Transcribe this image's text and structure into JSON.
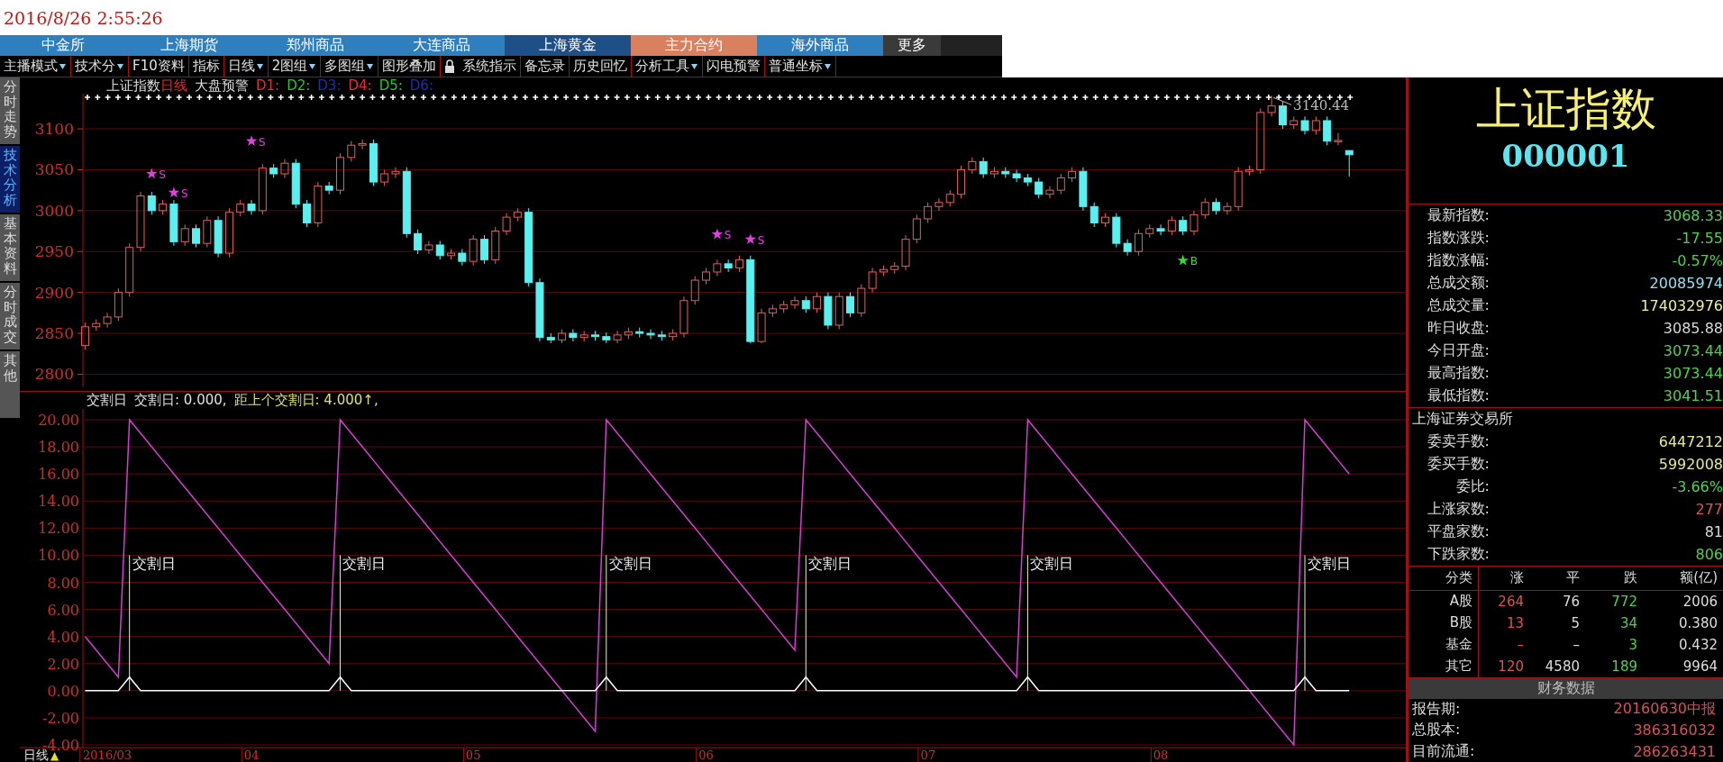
{
  "clock": "2016/8/26 2:55:26",
  "market_tabs": [
    {
      "label": "中金所",
      "color": "#2f7fbf"
    },
    {
      "label": "上海期货",
      "color": "#2f7fbf"
    },
    {
      "label": "郑州商品",
      "color": "#2f7fbf"
    },
    {
      "label": "大连商品",
      "color": "#2f7fbf"
    },
    {
      "label": "上海黄金",
      "color": "#1e4f86"
    },
    {
      "label": "主力合约",
      "color": "#d9805f"
    },
    {
      "label": "海外商品",
      "color": "#2f7fbf"
    },
    {
      "label": "更多",
      "color": "#3a3a3a"
    }
  ],
  "toolbar": [
    {
      "label": "主播模式",
      "dropdown": true
    },
    {
      "label": "技术分",
      "dropdown": true
    },
    {
      "label": "F10资料",
      "dropdown": false
    },
    {
      "label": "指标",
      "dropdown": false
    },
    {
      "label": "日线",
      "dropdown": true
    },
    {
      "label": "2图组",
      "dropdown": true
    },
    {
      "label": "多图组",
      "dropdown": true
    },
    {
      "label": "图形叠加",
      "dropdown": false
    },
    {
      "kind": "lock"
    },
    {
      "label": "系统指示",
      "dropdown": false
    },
    {
      "label": "备忘录",
      "dropdown": false
    },
    {
      "label": "历史回忆",
      "dropdown": false
    },
    {
      "label": "分析工具",
      "dropdown": true
    },
    {
      "label": "闪电预警",
      "dropdown": false
    },
    {
      "label": "普通坐标",
      "dropdown": true
    }
  ],
  "side_tabs": [
    {
      "label": "分时走势",
      "selected": false
    },
    {
      "label": "技术分析",
      "selected": true
    },
    {
      "label": "基本资料",
      "selected": false
    },
    {
      "label": "分时成交",
      "selected": false
    },
    {
      "label": "其他",
      "selected": false
    }
  ],
  "price_chart": {
    "title": "上证指数",
    "period": "日线",
    "alert": "大盘预警",
    "d_labels": [
      {
        "text": "D1:",
        "color": "#e03030"
      },
      {
        "text": "D2:",
        "color": "#30c030"
      },
      {
        "text": "D3:",
        "color": "#2030a0"
      },
      {
        "text": "D4:",
        "color": "#e03030"
      },
      {
        "text": "D5:",
        "color": "#30c030"
      },
      {
        "text": "D6:",
        "color": "#2030a0"
      }
    ],
    "high_label": "3140.44",
    "signals": [
      {
        "kind": "sell",
        "text": "S"
      },
      {
        "kind": "sell",
        "text": "S"
      },
      {
        "kind": "sell",
        "text": "S"
      },
      {
        "kind": "sell",
        "text": "S"
      },
      {
        "kind": "sell",
        "text": "S"
      },
      {
        "kind": "buy",
        "text": "B"
      }
    ],
    "chart_data": {
      "type": "candlestick",
      "grid": true,
      "categories": [
        null,
        null,
        null,
        null,
        null,
        null,
        null,
        null,
        null,
        null,
        null,
        null,
        null,
        null,
        null,
        null,
        null,
        null,
        null,
        null,
        null,
        null,
        null,
        null,
        null,
        null,
        null,
        null,
        null,
        null,
        null,
        null,
        null,
        null,
        null,
        null,
        null,
        null,
        null,
        null,
        null,
        null,
        null,
        null,
        null,
        null,
        null,
        null,
        null,
        null,
        null,
        null,
        null,
        null,
        null,
        null,
        null,
        null,
        null,
        null,
        null,
        null,
        null,
        null,
        null,
        null,
        null,
        null,
        null,
        null,
        null,
        null,
        null,
        null,
        null,
        null,
        null,
        null,
        null,
        null,
        null,
        null,
        null,
        null,
        null,
        null,
        null,
        null,
        null,
        null,
        null,
        null,
        null,
        null,
        null,
        null,
        null,
        null,
        null,
        null,
        null,
        null,
        null,
        null,
        null,
        null,
        null,
        null,
        null,
        null,
        null,
        null,
        null,
        null,
        null
      ],
      "ohlc": [
        [
          2835,
          2863,
          2830,
          2858
        ],
        [
          2858,
          2867,
          2853,
          2862
        ],
        [
          2862,
          2875,
          2857,
          2870
        ],
        [
          2870,
          2905,
          2865,
          2900
        ],
        [
          2900,
          2960,
          2895,
          2955
        ],
        [
          2955,
          3023,
          2950,
          3018
        ],
        [
          3018,
          3023,
          2995,
          3000
        ],
        [
          3000,
          3013,
          2995,
          3008
        ],
        [
          3008,
          3013,
          2957,
          2962
        ],
        [
          2962,
          2983,
          2957,
          2978
        ],
        [
          2978,
          2983,
          2955,
          2960
        ],
        [
          2960,
          2993,
          2955,
          2988
        ],
        [
          2988,
          2993,
          2943,
          2948
        ],
        [
          2948,
          3003,
          2943,
          2998
        ],
        [
          2998,
          3013,
          2993,
          3008
        ],
        [
          3008,
          3013,
          2995,
          3000
        ],
        [
          3000,
          3057,
          2995,
          3052
        ],
        [
          3052,
          3057,
          3040,
          3045
        ],
        [
          3045,
          3063,
          3040,
          3058
        ],
        [
          3058,
          3063,
          3003,
          3008
        ],
        [
          3008,
          3013,
          2980,
          2985
        ],
        [
          2985,
          3035,
          2980,
          3030
        ],
        [
          3030,
          3035,
          3020,
          3025
        ],
        [
          3025,
          3070,
          3020,
          3065
        ],
        [
          3065,
          3085,
          3060,
          3080
        ],
        [
          3080,
          3087,
          3075,
          3082
        ],
        [
          3082,
          3087,
          3030,
          3035
        ],
        [
          3035,
          3050,
          3030,
          3045
        ],
        [
          3045,
          3053,
          3040,
          3048
        ],
        [
          3048,
          3053,
          2967,
          2972
        ],
        [
          2972,
          2977,
          2947,
          2952
        ],
        [
          2952,
          2963,
          2947,
          2958
        ],
        [
          2958,
          2963,
          2940,
          2945
        ],
        [
          2945,
          2953,
          2940,
          2948
        ],
        [
          2948,
          2953,
          2933,
          2938
        ],
        [
          2938,
          2970,
          2933,
          2965
        ],
        [
          2965,
          2970,
          2935,
          2940
        ],
        [
          2940,
          2980,
          2935,
          2975
        ],
        [
          2975,
          2997,
          2970,
          2992
        ],
        [
          2992,
          3003,
          2987,
          2998
        ],
        [
          2998,
          3003,
          2907,
          2912
        ],
        [
          2912,
          2917,
          2840,
          2845
        ],
        [
          2845,
          2850,
          2838,
          2842
        ],
        [
          2842,
          2855,
          2838,
          2850
        ],
        [
          2850,
          2855,
          2840,
          2845
        ],
        [
          2845,
          2853,
          2840,
          2848
        ],
        [
          2848,
          2853,
          2841,
          2846
        ],
        [
          2846,
          2851,
          2838,
          2842
        ],
        [
          2842,
          2853,
          2838,
          2848
        ],
        [
          2848,
          2857,
          2843,
          2852
        ],
        [
          2852,
          2857,
          2845,
          2850
        ],
        [
          2850,
          2855,
          2843,
          2848
        ],
        [
          2848,
          2853,
          2841,
          2846
        ],
        [
          2846,
          2855,
          2841,
          2850
        ],
        [
          2850,
          2895,
          2845,
          2890
        ],
        [
          2890,
          2920,
          2885,
          2915
        ],
        [
          2915,
          2930,
          2910,
          2925
        ],
        [
          2925,
          2940,
          2920,
          2935
        ],
        [
          2935,
          2940,
          2925,
          2930
        ],
        [
          2930,
          2945,
          2925,
          2940
        ],
        [
          2940,
          2945,
          2838,
          2840
        ],
        [
          2840,
          2880,
          2838,
          2875
        ],
        [
          2875,
          2885,
          2870,
          2880
        ],
        [
          2880,
          2890,
          2875,
          2885
        ],
        [
          2885,
          2895,
          2880,
          2890
        ],
        [
          2890,
          2895,
          2875,
          2880
        ],
        [
          2880,
          2900,
          2875,
          2895
        ],
        [
          2895,
          2900,
          2855,
          2860
        ],
        [
          2860,
          2900,
          2855,
          2895
        ],
        [
          2895,
          2900,
          2870,
          2875
        ],
        [
          2875,
          2910,
          2870,
          2905
        ],
        [
          2905,
          2930,
          2900,
          2925
        ],
        [
          2925,
          2933,
          2920,
          2928
        ],
        [
          2928,
          2937,
          2923,
          2932
        ],
        [
          2932,
          2970,
          2927,
          2965
        ],
        [
          2965,
          2995,
          2960,
          2990
        ],
        [
          2990,
          3010,
          2985,
          3005
        ],
        [
          3005,
          3015,
          3000,
          3010
        ],
        [
          3010,
          3025,
          3005,
          3020
        ],
        [
          3020,
          3055,
          3015,
          3050
        ],
        [
          3050,
          3065,
          3045,
          3060
        ],
        [
          3060,
          3065,
          3040,
          3045
        ],
        [
          3045,
          3053,
          3040,
          3048
        ],
        [
          3048,
          3053,
          3040,
          3045
        ],
        [
          3045,
          3050,
          3035,
          3040
        ],
        [
          3040,
          3045,
          3030,
          3035
        ],
        [
          3035,
          3040,
          3015,
          3020
        ],
        [
          3020,
          3030,
          3015,
          3025
        ],
        [
          3025,
          3045,
          3020,
          3040
        ],
        [
          3040,
          3053,
          3035,
          3048
        ],
        [
          3048,
          3053,
          3000,
          3005
        ],
        [
          3005,
          3010,
          2980,
          2985
        ],
        [
          2985,
          2997,
          2980,
          2992
        ],
        [
          2992,
          2997,
          2955,
          2960
        ],
        [
          2960,
          2965,
          2945,
          2950
        ],
        [
          2950,
          2977,
          2945,
          2972
        ],
        [
          2972,
          2983,
          2967,
          2978
        ],
        [
          2978,
          2983,
          2970,
          2975
        ],
        [
          2975,
          2993,
          2970,
          2988
        ],
        [
          2988,
          2993,
          2970,
          2975
        ],
        [
          2975,
          3000,
          2970,
          2995
        ],
        [
          2995,
          3015,
          2990,
          3010
        ],
        [
          3010,
          3015,
          2995,
          3000
        ],
        [
          3000,
          3010,
          2995,
          3005
        ],
        [
          3005,
          3053,
          3000,
          3048
        ],
        [
          3048,
          3055,
          3043,
          3050
        ],
        [
          3050,
          3125,
          3045,
          3120
        ],
        [
          3120,
          3140.44,
          3115,
          3128
        ],
        [
          3128,
          3133,
          3100,
          3105
        ],
        [
          3105,
          3115,
          3100,
          3110
        ],
        [
          3110,
          3115,
          3093,
          3098
        ],
        [
          3098,
          3115,
          3093,
          3110
        ],
        [
          3110,
          3115,
          3080,
          3085
        ],
        [
          3085,
          3095,
          3080,
          3085.88
        ],
        [
          3073.44,
          3073.44,
          3041.51,
          3068.33
        ]
      ],
      "ylim": [
        2784,
        3143
      ],
      "yticks": [
        {
          "value": 3100,
          "label": "3100"
        },
        {
          "value": 3050,
          "label": "3050"
        },
        {
          "value": 3000,
          "label": "3000"
        },
        {
          "value": 2950,
          "label": "2950"
        },
        {
          "value": 2900,
          "label": "2900"
        },
        {
          "value": 2850,
          "label": "2850"
        },
        {
          "value": 2800,
          "label": "2800"
        }
      ]
    }
  },
  "indicator": {
    "legend": [
      {
        "text": "交割日",
        "color": "#e0e0e0"
      },
      {
        "text": "交割日: 0.000,",
        "color": "#e0e0e0"
      },
      {
        "text": "距上个交割日: 4.000↑,",
        "color": "#e0e070"
      }
    ],
    "chart_data": {
      "type": "line",
      "categories": [
        null,
        null,
        "2016/03",
        null,
        null,
        null,
        null,
        null,
        null,
        null,
        null,
        null,
        null,
        null,
        null,
        "04",
        null,
        null,
        null,
        null,
        null,
        null,
        null,
        null,
        null,
        null,
        null,
        null,
        null,
        null,
        null,
        null,
        null,
        null,
        null,
        "05",
        null,
        null,
        null,
        null,
        null,
        null,
        null,
        null,
        null,
        null,
        null,
        null,
        null,
        null,
        null,
        null,
        null,
        null,
        null,
        null,
        "06",
        null,
        null,
        null,
        null,
        null,
        null,
        null,
        null,
        null,
        null,
        null,
        null,
        null,
        null,
        null,
        null,
        null,
        null,
        null,
        "07",
        null,
        null,
        null,
        null,
        null,
        null,
        null,
        null,
        null,
        null,
        null,
        null,
        null,
        null,
        null,
        null,
        null,
        null,
        null,
        null,
        "08",
        null,
        null,
        null,
        null,
        null,
        null,
        null,
        null,
        null,
        null,
        null,
        null,
        null,
        null,
        null,
        null,
        null
      ],
      "series": [
        {
          "color": "#d040d0",
          "values": [
            4,
            3,
            2,
            1,
            20,
            19,
            18,
            17,
            16,
            15,
            14,
            13,
            12,
            11,
            10,
            9,
            8,
            7,
            6,
            5,
            4,
            3,
            2,
            20,
            19,
            18,
            17,
            16,
            15,
            14,
            13,
            12,
            11,
            10,
            9,
            8,
            7,
            6,
            5,
            4,
            3,
            2,
            1,
            0,
            -1,
            -2,
            -3,
            20,
            19,
            18,
            17,
            16,
            15,
            14,
            13,
            12,
            11,
            10,
            9,
            8,
            7,
            6,
            5,
            4,
            3,
            20,
            19,
            18,
            17,
            16,
            15,
            14,
            13,
            12,
            11,
            10,
            9,
            8,
            7,
            6,
            5,
            4,
            3,
            2,
            1,
            20,
            19,
            18,
            17,
            16,
            15,
            14,
            13,
            12,
            11,
            10,
            9,
            8,
            7,
            6,
            5,
            4,
            3,
            2,
            1,
            0,
            -1,
            -2,
            -3,
            -4,
            20,
            19,
            18,
            17,
            16
          ]
        },
        {
          "color": "#ffffff",
          "values": [
            0,
            0,
            0,
            0,
            1,
            0,
            0,
            0,
            0,
            0,
            0,
            0,
            0,
            0,
            0,
            0,
            0,
            0,
            0,
            0,
            0,
            0,
            0,
            1,
            0,
            0,
            0,
            0,
            0,
            0,
            0,
            0,
            0,
            0,
            0,
            0,
            0,
            0,
            0,
            0,
            0,
            0,
            0,
            0,
            0,
            0,
            0,
            1,
            0,
            0,
            0,
            0,
            0,
            0,
            0,
            0,
            0,
            0,
            0,
            0,
            0,
            0,
            0,
            0,
            0,
            1,
            0,
            0,
            0,
            0,
            0,
            0,
            0,
            0,
            0,
            0,
            0,
            0,
            0,
            0,
            0,
            0,
            0,
            0,
            0,
            1,
            0,
            0,
            0,
            0,
            0,
            0,
            0,
            0,
            0,
            0,
            0,
            0,
            0,
            0,
            0,
            0,
            0,
            0,
            0,
            0,
            0,
            0,
            0,
            0,
            1,
            0,
            0,
            0,
            0
          ]
        }
      ],
      "ylim": [
        -4,
        20
      ],
      "grid": true,
      "yticks": [
        {
          "value": 20,
          "label": "20.00"
        },
        {
          "value": 18,
          "label": "18.00"
        },
        {
          "value": 16,
          "label": "16.00"
        },
        {
          "value": 14,
          "label": "14.00"
        },
        {
          "value": 12,
          "label": "12.00"
        },
        {
          "value": 10,
          "label": "10.00"
        },
        {
          "value": 8,
          "label": "8.00"
        },
        {
          "value": 6,
          "label": "6.00"
        },
        {
          "value": 4,
          "label": "4.00"
        },
        {
          "value": 2,
          "label": "2.00"
        },
        {
          "value": 0,
          "label": "0.00"
        },
        {
          "value": -2,
          "label": "-2.00"
        },
        {
          "value": -4,
          "label": "-4.00"
        }
      ],
      "annotations": [
        "交割日",
        "交割日",
        "交割日",
        "交割日",
        "交割日",
        "交割日"
      ]
    }
  },
  "period_button": {
    "label": "日线",
    "icon": "▲"
  },
  "quote": {
    "name": "上证指数",
    "code": "000001",
    "stats": [
      {
        "label": "最新指数:",
        "value": "3068.33",
        "color": "#50d050"
      },
      {
        "label": "指数涨跌:",
        "value": "-17.55",
        "color": "#50d050"
      },
      {
        "label": "指数涨幅:",
        "value": "-0.57%",
        "color": "#50d050"
      },
      {
        "label": "总成交额:",
        "value": "20085974",
        "color": "#90e0f0"
      },
      {
        "label": "总成交量:",
        "value": "174032976",
        "color": "#f0f090"
      },
      {
        "label": "昨日收盘:",
        "value": "3085.88",
        "color": "#d8d8d8"
      },
      {
        "label": "今日开盘:",
        "value": "3073.44",
        "color": "#50d050"
      },
      {
        "label": "最高指数:",
        "value": "3073.44",
        "color": "#50d050"
      },
      {
        "label": "最低指数:",
        "value": "3041.51",
        "color": "#50d050"
      }
    ],
    "exchange": "上海证券交易所",
    "orders": [
      {
        "label": "委卖手数:",
        "value": "6447212",
        "color": "#e8e890"
      },
      {
        "label": "委买手数:",
        "value": "5992008",
        "color": "#e8e890"
      },
      {
        "label": "委比:",
        "value": "-3.66%",
        "color": "#50d050"
      },
      {
        "label": "上涨家数:",
        "value": "277",
        "color": "#e05050"
      },
      {
        "label": "平盘家数:",
        "value": "81",
        "color": "#d8d8d8"
      },
      {
        "label": "下跌家数:",
        "value": "806",
        "color": "#50d050"
      }
    ],
    "breadth": {
      "columns": [
        "分类",
        "涨",
        "平",
        "跌",
        "额(亿)"
      ],
      "rows": [
        [
          "A股",
          "264",
          "76",
          "772",
          "2006"
        ],
        [
          "B股",
          "13",
          "5",
          "34",
          "0.380"
        ],
        [
          "基金",
          "–",
          "–",
          "3",
          "0.432"
        ],
        [
          "其它",
          "120",
          "4580",
          "189",
          "9964"
        ]
      ]
    },
    "finance_title": "财务数据",
    "finance": [
      {
        "label": "报告期:",
        "value": "20160630中报"
      },
      {
        "label": "总股本:",
        "value": "386316032"
      },
      {
        "label": "目前流通:",
        "value": "286263431"
      }
    ]
  }
}
